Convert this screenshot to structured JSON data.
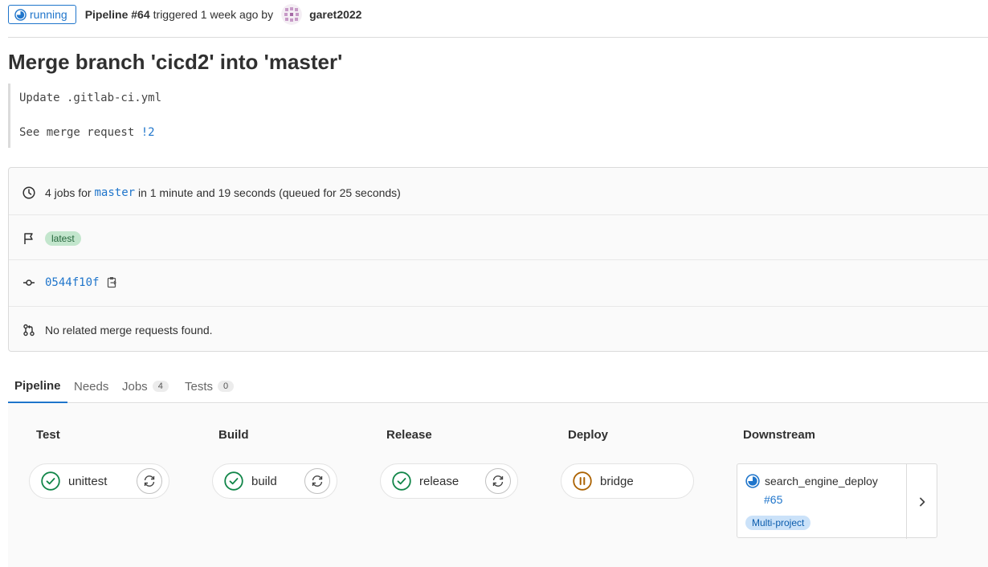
{
  "header": {
    "status": "running",
    "pipeline_id": "Pipeline #64",
    "triggered_text": "triggered 1 week ago by",
    "user": "garet2022"
  },
  "title": "Merge branch 'cicd2' into 'master'",
  "commit_message": {
    "line1": "Update .gitlab-ci.yml",
    "line2_prefix": "See merge request ",
    "mr_link": "!2"
  },
  "info": {
    "jobs_prefix": "4 jobs for ",
    "branch": "master",
    "jobs_suffix": " in 1 minute and 19 seconds (queued for 25 seconds)",
    "badge": "latest",
    "sha": "0544f10f",
    "merge_requests": "No related merge requests found."
  },
  "tabs": [
    {
      "label": "Pipeline",
      "count": null
    },
    {
      "label": "Needs",
      "count": null
    },
    {
      "label": "Jobs",
      "count": "4"
    },
    {
      "label": "Tests",
      "count": "0"
    }
  ],
  "stages": [
    {
      "title": "Test",
      "job": "unittest",
      "status": "success"
    },
    {
      "title": "Build",
      "job": "build",
      "status": "success"
    },
    {
      "title": "Release",
      "job": "release",
      "status": "success"
    },
    {
      "title": "Deploy",
      "job": "bridge",
      "status": "manual-paused"
    }
  ],
  "downstream": {
    "title": "Downstream",
    "name": "search_engine_deploy",
    "pipeline": "#65",
    "badge": "Multi-project",
    "status": "running"
  },
  "colors": {
    "accent": "#1f75cb",
    "success": "#108548",
    "paused": "#ab6100"
  }
}
